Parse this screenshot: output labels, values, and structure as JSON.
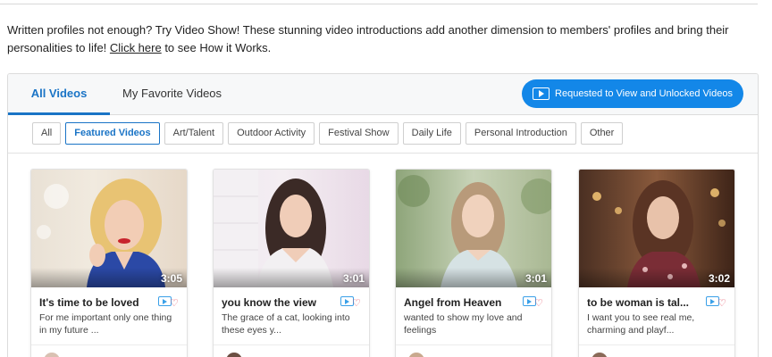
{
  "intro": {
    "text_before": "Written profiles not enough? Try Video Show! These stunning video introductions add another dimension to members' profiles and bring their personalities to life! ",
    "link": "Click here",
    "text_after": " to see How it Works."
  },
  "tabs": [
    {
      "label": "All Videos",
      "active": true
    },
    {
      "label": "My Favorite Videos",
      "active": false
    }
  ],
  "request_button": {
    "label": "Requested to View and Unlocked Videos",
    "icon": "play-square-icon"
  },
  "filters": [
    {
      "label": "All",
      "active": false
    },
    {
      "label": "Featured Videos",
      "active": true
    },
    {
      "label": "Art/Talent",
      "active": false
    },
    {
      "label": "Outdoor Activity",
      "active": false
    },
    {
      "label": "Festival Show",
      "active": false
    },
    {
      "label": "Daily Life",
      "active": false
    },
    {
      "label": "Personal Introduction",
      "active": false
    },
    {
      "label": "Other",
      "active": false
    }
  ],
  "videos": [
    {
      "title": "It's time to be loved",
      "description": "For me important only one thing in my future ...",
      "duration": "3:05"
    },
    {
      "title": "you know the view",
      "description": "The grace of a cat, looking into these eyes y...",
      "duration": "3:01"
    },
    {
      "title": "Angel from Heaven",
      "description": "wanted to show my love and feelings",
      "duration": "3:01"
    },
    {
      "title": "to be woman is tal...",
      "description": "I want you to see real me, charming and playf...",
      "duration": "3:02"
    }
  ],
  "colors": {
    "accent": "#1a74c6",
    "button": "#1387e8",
    "heart": "#e0475b"
  }
}
